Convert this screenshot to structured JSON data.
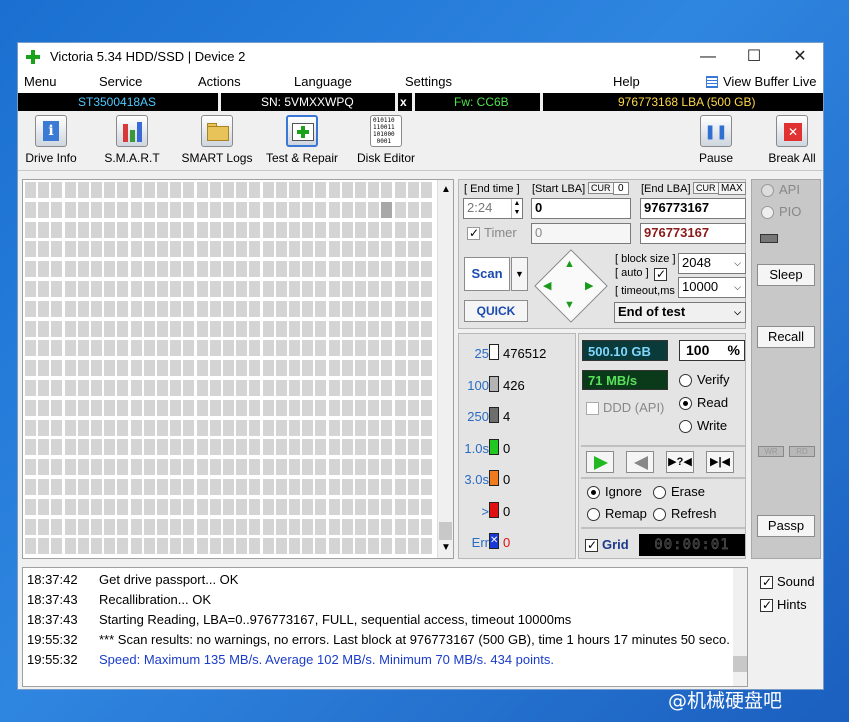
{
  "window": {
    "title": "Victoria 5.34 HDD/SSD | Device 2",
    "minimize": "—",
    "maximize": "☐",
    "close": "✕"
  },
  "menu": {
    "items": [
      "Menu",
      "Service",
      "Actions",
      "Language",
      "Settings",
      "Help"
    ],
    "view_buffer": "View Buffer Live"
  },
  "infobar": {
    "model": "ST3500418AS",
    "serial": "SN: 5VMXXWPQ",
    "x": "x",
    "firmware": "Fw: CC6B",
    "capacity": "976773168 LBA (500 GB)"
  },
  "toolbar": {
    "drive_info": "Drive Info",
    "smart": "S.M.A.R.T",
    "smart_logs": "SMART Logs",
    "test_repair": "Test & Repair",
    "disk_editor": "Disk Editor",
    "pause": "Pause",
    "break_all": "Break All",
    "pause_glyph": "❚❚",
    "break_glyph": "✕",
    "disk_editor_glyph": "010110\n110011\n101000\n0001"
  },
  "test": {
    "end_time_label": "[ End time ]",
    "end_time_value": "2:24",
    "start_lba_label": "[Start LBA]",
    "cur_label": "CUR",
    "start_cur_value": "0",
    "start_lba_value": "0",
    "end_lba_label": "[End LBA]",
    "end_cur_label": "CUR",
    "max_label": "MAX",
    "end_lba_value": "976773167",
    "timer_label": "Timer",
    "timer_value": "0",
    "end_lba_value2": "976773167",
    "scan_button": "Scan",
    "quick_button": "QUICK",
    "block_size_label": "[ block size ]",
    "auto_label": "[ auto ]",
    "block_size_value": "2048",
    "timeout_label": "[ timeout,ms ]",
    "timeout_value": "10000",
    "end_of_test": "End of test"
  },
  "stats": [
    {
      "label": "25",
      "count": "476512",
      "color": "#ffffff"
    },
    {
      "label": "100",
      "count": "426",
      "color": "#b4b4b4"
    },
    {
      "label": "250",
      "count": "4",
      "color": "#6e6e6e"
    },
    {
      "label": "1.0s",
      "count": "0",
      "color": "#22c822"
    },
    {
      "label": "3.0s",
      "count": "0",
      "color": "#f07a1e"
    },
    {
      "label": ">",
      "count": "0",
      "color": "#e01010"
    },
    {
      "label": "Err",
      "count": "0",
      "color": "#1a3ad8"
    }
  ],
  "progress": {
    "size_done": "500.10 GB",
    "percent": "100",
    "percent_sign": "%",
    "speed": "71 MB/s",
    "ddd_api": "DDD (API)",
    "verify": "Verify",
    "read": "Read",
    "write": "Write",
    "mode_selected": "Read",
    "ignore": "Ignore",
    "erase": "Erase",
    "remap": "Remap",
    "refresh": "Refresh",
    "grid": "Grid",
    "elapsed": "00:00:01"
  },
  "right": {
    "api": "API",
    "pio": "PIO",
    "sleep": "Sleep",
    "recall": "Recall",
    "wr": "WR",
    "rd": "RD",
    "passp": "Passp"
  },
  "log": [
    {
      "time": "18:37:42",
      "text": "Get drive passport... OK",
      "color": "#000000"
    },
    {
      "time": "18:37:43",
      "text": "Recallibration... OK",
      "color": "#000000"
    },
    {
      "time": "18:37:43",
      "text": "Starting Reading, LBA=0..976773167, FULL, sequential access, timeout 10000ms",
      "color": "#000000"
    },
    {
      "time": "19:55:32",
      "text": "*** Scan results: no warnings, no errors. Last block at 976773167 (500 GB), time 1 hours 17 minutes 50 seco.",
      "color": "#000000"
    },
    {
      "time": "19:55:32",
      "text": "Speed: Maximum 135 MB/s. Average 102 MB/s. Minimum 70 MB/s. 434 points.",
      "color": "#1a3cc8"
    }
  ],
  "options": {
    "sound": "Sound",
    "hints": "Hints"
  },
  "watermark": "@机械硬盘吧"
}
